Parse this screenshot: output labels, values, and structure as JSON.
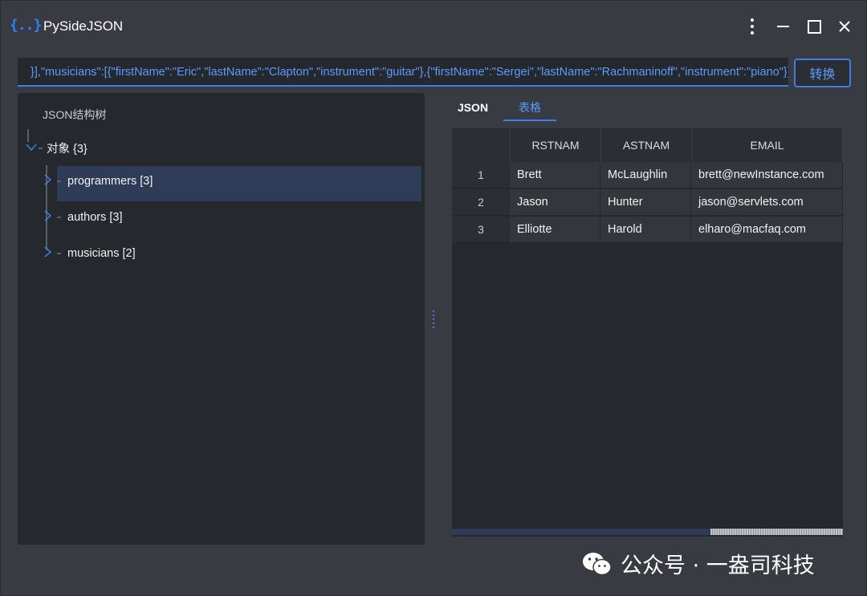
{
  "app": {
    "title": "PySideJSON",
    "icon_text": "{..}"
  },
  "input": {
    "value": "}],\"musicians\":[{\"firstName\":\"Eric\",\"lastName\":\"Clapton\",\"instrument\":\"guitar\"},{\"firstName\":\"Sergei\",\"lastName\":\"Rachmaninoff\",\"instrument\":\"piano\"}]}",
    "button_label": "转换"
  },
  "tree": {
    "header": "JSON结构树",
    "root": {
      "label": "对象 {3}",
      "expanded": true
    },
    "children": [
      {
        "label": "programmers [3]",
        "selected": true
      },
      {
        "label": "authors [3]",
        "selected": false
      },
      {
        "label": "musicians [2]",
        "selected": false
      }
    ]
  },
  "tabs": [
    {
      "label": "JSON",
      "active": false
    },
    {
      "label": "表格",
      "active": true
    }
  ],
  "table": {
    "columns": [
      "RSTNAM",
      "ASTNAM",
      "EMAIL"
    ],
    "rows": [
      {
        "num": "1",
        "cells": [
          "Brett",
          "McLaughlin",
          "brett@newInstance.com"
        ]
      },
      {
        "num": "2",
        "cells": [
          "Jason",
          "Hunter",
          "jason@servlets.com"
        ]
      },
      {
        "num": "3",
        "cells": [
          "Elliotte",
          "Harold",
          "elharo@macfaq.com"
        ]
      }
    ]
  },
  "watermark": {
    "text": "公众号 · 一盎司科技"
  },
  "colors": {
    "accent": "#3d7ee8",
    "background": "#383c42",
    "panel": "#25282c",
    "selected_row": "#2e3c58"
  }
}
